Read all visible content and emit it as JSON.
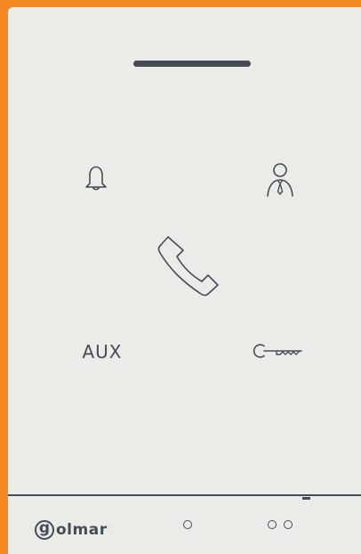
{
  "colors": {
    "frame": "#f58a25",
    "panel": "#ebebe8",
    "ink": "#454c57"
  },
  "panel": {
    "speaker": "speaker-slot",
    "buttons": {
      "bell": {
        "icon": "bell-icon"
      },
      "concierge": {
        "icon": "concierge-person-icon"
      },
      "call": {
        "icon": "phone-handset-icon"
      },
      "aux": {
        "label": "AUX"
      },
      "door": {
        "icon": "key-icon"
      }
    }
  },
  "footer": {
    "brand": {
      "mark": "g",
      "wordmark": "olmar"
    },
    "indicators": {
      "single": {
        "icon": "single-circle-indicator"
      },
      "double": {
        "icon": "double-circle-indicator"
      }
    }
  }
}
